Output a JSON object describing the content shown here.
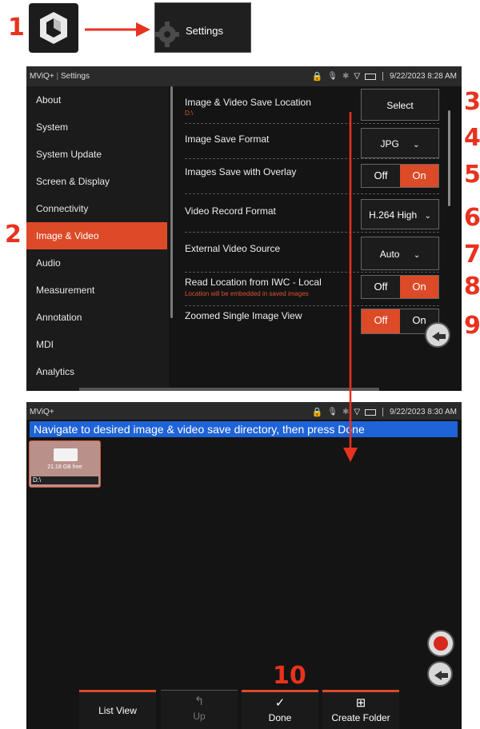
{
  "callouts": [
    "1",
    "2",
    "3",
    "4",
    "5",
    "6",
    "7",
    "8",
    "9",
    "10"
  ],
  "top": {
    "settings_label": "Settings"
  },
  "screen1": {
    "status": {
      "app": "MViQ+",
      "section": "Settings",
      "datetime": "9/22/2023 8:28 AM"
    },
    "sidebar": [
      "About",
      "System",
      "System Update",
      "Screen & Display",
      "Connectivity",
      "Image & Video",
      "Audio",
      "Measurement",
      "Annotation",
      "MDI",
      "Analytics"
    ],
    "settings": {
      "save_location": {
        "title": "Image & Video Save Location",
        "sub": "D:\\",
        "button": "Select"
      },
      "save_format": {
        "title": "Image Save Format",
        "value": "JPG"
      },
      "overlay": {
        "title": "Images Save with Overlay",
        "off": "Off",
        "on": "On"
      },
      "video_format": {
        "title": "Video Record Format",
        "value": "H.264 High"
      },
      "ext_source": {
        "title": "External Video Source",
        "value": "Auto"
      },
      "iwc": {
        "title": "Read Location from IWC - Local",
        "sub": "Location will be embedded in saved images",
        "off": "Off",
        "on": "On"
      },
      "zoomed": {
        "title": "Zoomed Single Image View",
        "off": "Off",
        "on": "On"
      }
    }
  },
  "screen2": {
    "status": {
      "app": "MViQ+",
      "datetime": "9/22/2023 8:30 AM"
    },
    "banner": "Navigate to desired image & video save directory, then press Done",
    "drive": {
      "free": "21.18 GB free",
      "path": "D:\\"
    },
    "tabs": {
      "list_view": "List View",
      "up": "Up",
      "done": "Done",
      "create_folder": "Create Folder"
    }
  },
  "colors": {
    "accent": "#dc4a28",
    "callout": "#e8321f",
    "banner": "#1e63d8"
  }
}
